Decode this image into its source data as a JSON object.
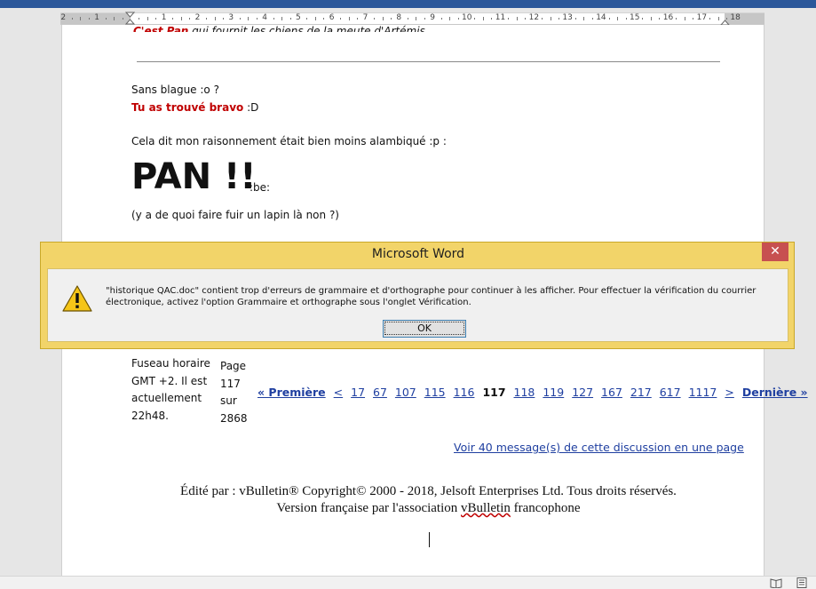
{
  "ruler": {
    "numbers": [
      "2",
      "1",
      "1",
      "2",
      "3",
      "4",
      "5",
      "6",
      "7",
      "8",
      "9",
      "10",
      "11",
      "12",
      "13",
      "14",
      "15",
      "16",
      "17",
      "18"
    ]
  },
  "document": {
    "top_line_prefix": "C'est Pan",
    "top_line_rest": " qui fournit les chiens de la meute d'Artémis.",
    "line1": "Sans blague :o ?",
    "line2_bold": "Tu as trouvé bravo",
    "line2_rest": " :D",
    "line3": "Cela dit mon raisonnement était bien moins alambiqué :p :",
    "pan": "PAN !!",
    "pan_smiley": ":be:",
    "line4": "(y a de quoi faire fuir un lapin là non ?)",
    "timezone": [
      "Fuseau horaire",
      "GMT +2. Il est",
      "actuellement",
      "22h48."
    ],
    "page_info": [
      "Page",
      "117",
      "sur",
      "2868"
    ],
    "pager": {
      "first": "« Première",
      "prev": "<",
      "pages_before": [
        "17",
        "67",
        "107",
        "115",
        "116"
      ],
      "current": "117",
      "pages_after": [
        "118",
        "119",
        "127",
        "167",
        "217",
        "617",
        "1117"
      ],
      "next": ">",
      "last": "Dernière »"
    },
    "view_all_link": "Voir 40 message(s) de cette discussion en une page",
    "footer_line1": "Édité par : vBulletin® Copyright© 2000 - 2018, Jelsoft Enterprises Ltd. Tous droits réservés.",
    "footer_line2_a": "Version française par l'association ",
    "footer_line2_b": "vBulletin",
    "footer_line2_c": " francophone"
  },
  "dialog": {
    "title": "Microsoft Word",
    "close_label": "✕",
    "message": "\"historique QAC.doc\" contient trop d'erreurs de grammaire et d'orthographe pour continuer à les afficher. Pour effectuer la vérification du courrier électronique, activez l'option Grammaire et orthographe sous l'onglet Vérification.",
    "ok_label": "OK",
    "icon": "warning-icon"
  },
  "colors": {
    "title_bar": "#2b579a",
    "dialog_frame": "#f2d469",
    "close_button": "#c75050",
    "link": "#1f3fa0",
    "emphasis_red": "#c00000"
  }
}
